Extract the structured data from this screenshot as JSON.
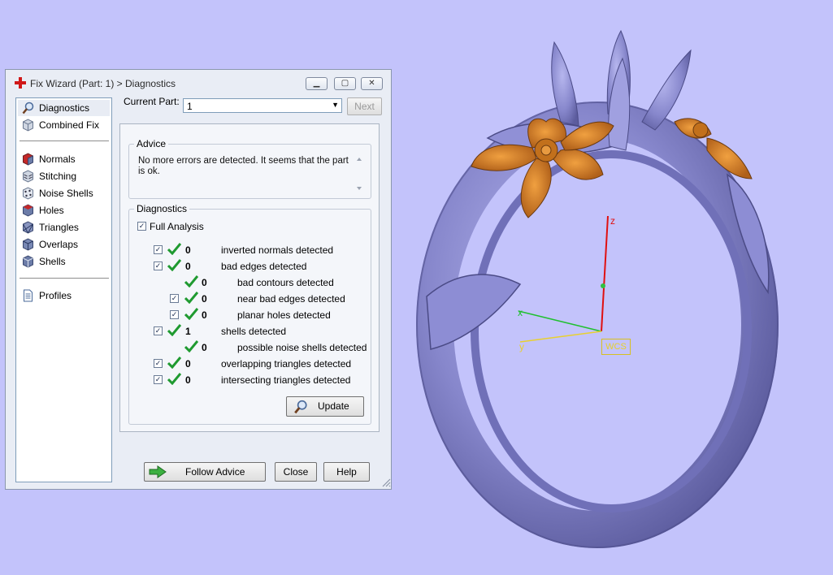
{
  "window": {
    "title": "Fix Wizard (Part: 1) > Diagnostics",
    "controls": {
      "minimize": "▁",
      "maximize": "▢",
      "close": "✕"
    }
  },
  "nav": {
    "items": [
      {
        "label": "Diagnostics",
        "icon": "magnifier-icon",
        "selected": true
      },
      {
        "label": "Combined Fix",
        "icon": "cube-icon"
      },
      {
        "label": "Normals",
        "icon": "normals-cube-icon"
      },
      {
        "label": "Stitching",
        "icon": "stitching-cube-icon"
      },
      {
        "label": "Noise Shells",
        "icon": "noise-shells-icon"
      },
      {
        "label": "Holes",
        "icon": "holes-cube-icon"
      },
      {
        "label": "Triangles",
        "icon": "triangles-cube-icon"
      },
      {
        "label": "Overlaps",
        "icon": "overlaps-cube-icon"
      },
      {
        "label": "Shells",
        "icon": "shells-cube-icon"
      },
      {
        "label": "Profiles",
        "icon": "document-icon"
      }
    ]
  },
  "current_part": {
    "label": "Current Part:",
    "value": "1",
    "next_label": "Next"
  },
  "advice": {
    "title": "Advice",
    "text": "No more errors are detected. It seems that the part is ok."
  },
  "diagnostics": {
    "title": "Diagnostics",
    "full_analysis": "Full Analysis",
    "rows": [
      {
        "count": "0",
        "label": "inverted normals detected",
        "checkbox": true
      },
      {
        "count": "0",
        "label": "bad edges detected",
        "checkbox": true
      },
      {
        "count": "0",
        "label": "bad contours detected",
        "checkbox": false
      },
      {
        "count": "0",
        "label": "near bad edges detected",
        "checkbox": true
      },
      {
        "count": "0",
        "label": "planar holes detected",
        "checkbox": true
      },
      {
        "count": "1",
        "label": "shells detected",
        "checkbox": true
      },
      {
        "count": "0",
        "label": "possible noise shells detected",
        "checkbox": false
      },
      {
        "count": "0",
        "label": "overlapping triangles detected",
        "checkbox": true
      },
      {
        "count": "0",
        "label": "intersecting triangles detected",
        "checkbox": true
      }
    ],
    "update_label": "Update"
  },
  "footer": {
    "follow_label": "Follow Advice",
    "close_label": "Close",
    "help_label": "Help"
  },
  "viewport": {
    "axis_z": "z",
    "axis_x": "x",
    "axis_y": "y",
    "wcs_label": "WCS",
    "colors": {
      "background": "#c3c3fb",
      "ring": "#8c8cd2",
      "flower": "#d07a20",
      "axis_z": "#e01010",
      "axis_x": "#20c030",
      "axis_y": "#e8d030"
    }
  }
}
